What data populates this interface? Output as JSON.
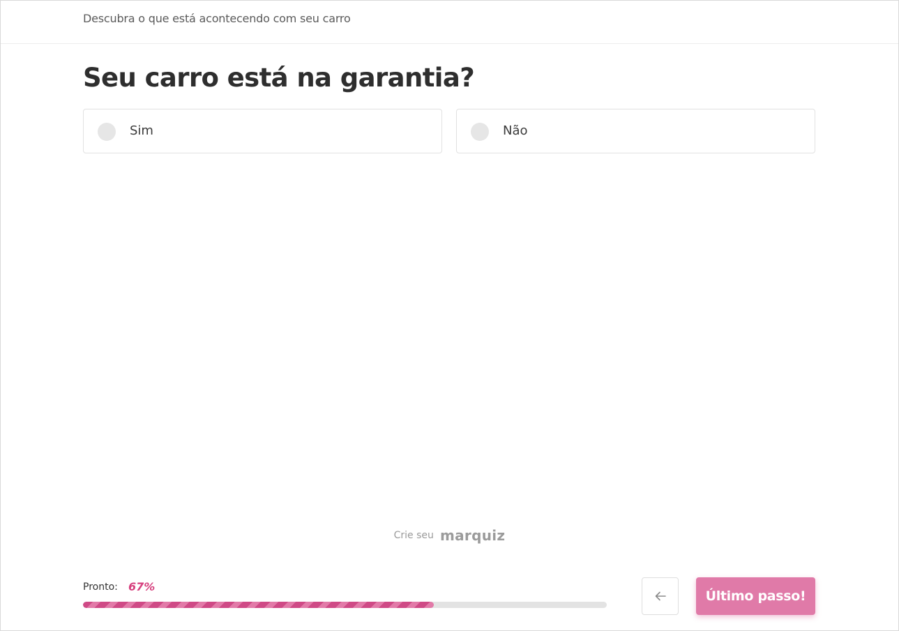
{
  "header": {
    "subtitle": "Descubra o que está acontecendo com seu carro"
  },
  "question": {
    "title": "Seu carro está na garantia?",
    "options": [
      {
        "label": "Sim",
        "selected": false
      },
      {
        "label": "Não",
        "selected": false
      }
    ]
  },
  "credit": {
    "prefix": "Crie seu",
    "brand": "marquiz"
  },
  "progress": {
    "label": "Pronto:",
    "value_text": "67%",
    "value": 0.67
  },
  "nav": {
    "back_icon": "arrow-left-icon",
    "next_label": "Último passo!"
  },
  "colors": {
    "accent": "#d6407e",
    "button": "#e07aa8",
    "track": "#e3e3e3"
  }
}
